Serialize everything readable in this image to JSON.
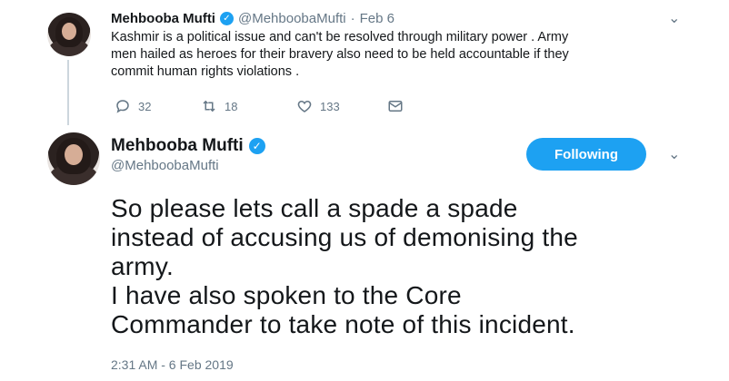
{
  "tweet1": {
    "name": "Mehbooba Mufti",
    "handle": "@MehboobaMufti",
    "separator": "·",
    "date": "Feb 6",
    "text_lines": [
      "Kashmir is a political issue and can't be resolved through military power . Army",
      "men hailed as heroes for their bravery also need to be held accountable if they",
      "commit human rights violations ."
    ],
    "reply_count": "32",
    "retweet_count": "18",
    "like_count": "133"
  },
  "tweet2": {
    "name": "Mehbooba Mufti",
    "handle": "@MehboobaMufti",
    "follow_label": "Following",
    "text_lines": [
      "So please lets call a spade a spade",
      "instead of accusing us of demonising the",
      "army.",
      "I have also spoken to the Core",
      "Commander to take note of this incident."
    ],
    "timestamp": "2:31 AM - 6 Feb 2019"
  },
  "colors": {
    "accent": "#1da1f2",
    "muted": "#657786",
    "text": "#14171a"
  },
  "icons": [
    "verified-icon",
    "chevron-down-icon",
    "reply-icon",
    "retweet-icon",
    "like-icon",
    "message-icon"
  ]
}
